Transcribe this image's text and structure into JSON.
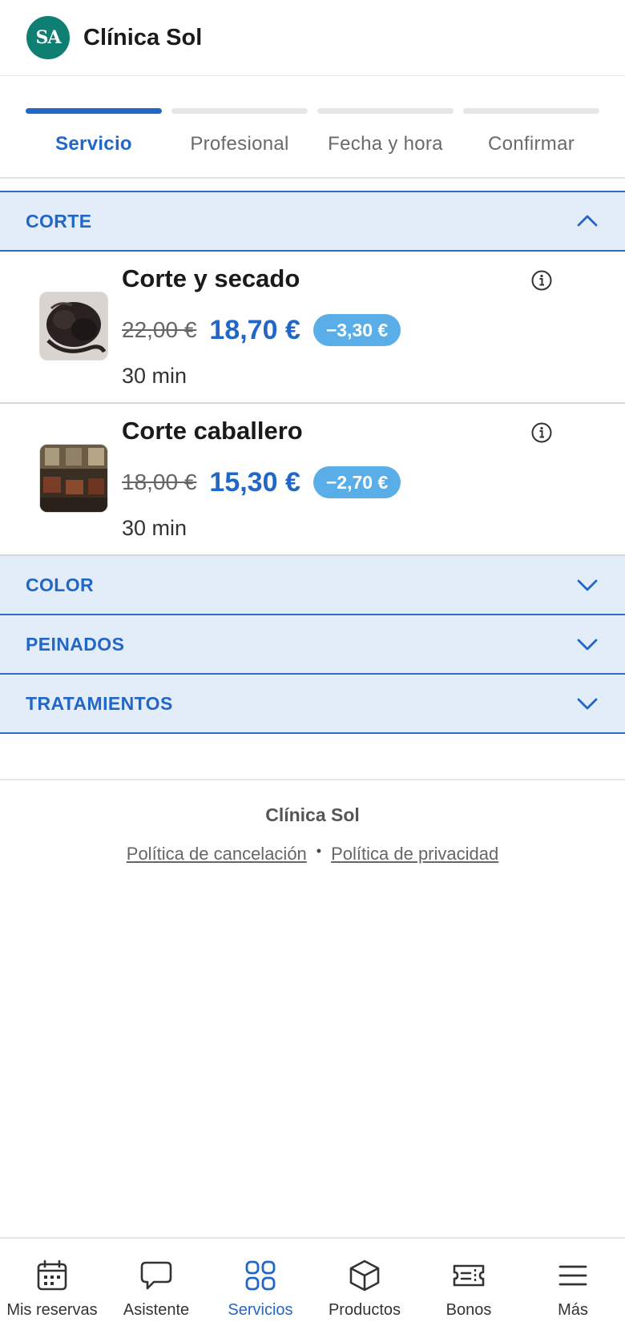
{
  "header": {
    "avatar_initials": "SA",
    "title": "Clínica Sol"
  },
  "stepper": {
    "steps": [
      {
        "label": "Servicio",
        "active": true
      },
      {
        "label": "Profesional",
        "active": false
      },
      {
        "label": "Fecha y hora",
        "active": false
      },
      {
        "label": "Confirmar",
        "active": false
      }
    ]
  },
  "categories": [
    {
      "label": "CORTE",
      "expanded": true,
      "services": [
        {
          "name": "Corte y secado",
          "old_price": "22,00 €",
          "price": "18,70 €",
          "discount": "−3,30 €",
          "duration": "30 min"
        },
        {
          "name": "Corte caballero",
          "old_price": "18,00 €",
          "price": "15,30 €",
          "discount": "−2,70 €",
          "duration": "30 min"
        }
      ]
    },
    {
      "label": "COLOR",
      "expanded": false
    },
    {
      "label": "PEINADOS",
      "expanded": false
    },
    {
      "label": "TRATAMIENTOS",
      "expanded": false
    }
  ],
  "footer": {
    "name": "Clínica Sol",
    "cancel_policy": "Política de cancelación",
    "separator": "•",
    "privacy_policy": "Política de privacidad"
  },
  "bottom_nav": {
    "items": [
      {
        "label": "Mis reservas",
        "icon": "calendar-icon",
        "active": false
      },
      {
        "label": "Asistente",
        "icon": "chat-bubble-icon",
        "active": false
      },
      {
        "label": "Servicios",
        "icon": "grid-icon",
        "active": true
      },
      {
        "label": "Productos",
        "icon": "box-icon",
        "active": false
      },
      {
        "label": "Bonos",
        "icon": "ticket-icon",
        "active": false
      },
      {
        "label": "Más",
        "icon": "menu-icon",
        "active": false
      }
    ]
  },
  "colors": {
    "accent": "#2267c8",
    "brand": "#0f7f74",
    "discount_badge": "#5aaee8",
    "category_bg": "#e3edf9"
  }
}
